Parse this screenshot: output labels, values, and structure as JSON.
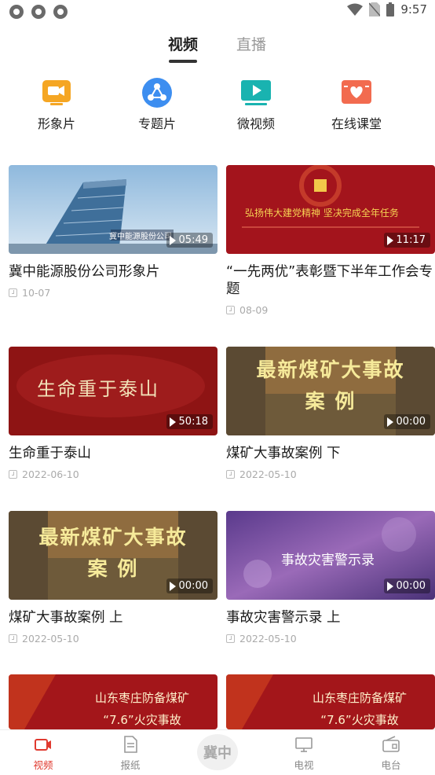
{
  "status_bar": {
    "time": "9:57"
  },
  "top_tabs": [
    {
      "label": "视频",
      "active": true
    },
    {
      "label": "直播",
      "active": false
    }
  ],
  "categories": [
    {
      "label": "形象片",
      "icon": "camera-icon",
      "color": "#f5a623"
    },
    {
      "label": "专题片",
      "icon": "share-circle-icon",
      "color": "#3d8ef0"
    },
    {
      "label": "微视频",
      "icon": "play-screen-icon",
      "color": "#19b3b0"
    },
    {
      "label": "在线课堂",
      "icon": "heart-board-icon",
      "color": "#f26b4f"
    }
  ],
  "videos": [
    {
      "title": "冀中能源股份公司形象片",
      "date": "10-07",
      "duration": "05:49",
      "thumb_text": "冀中能源股份公司"
    },
    {
      "title": "“一先两优”表彰暨下半年工作会专题",
      "date": "08-09",
      "duration": "11:17",
      "thumb_text": "弘扬伟大建党精神 坚决完成全年任务"
    },
    {
      "title": "生命重于泰山",
      "date": "2022-06-10",
      "duration": "50:18",
      "thumb_text": "生命重于泰山"
    },
    {
      "title": "煤矿大事故案例 下",
      "date": "2022-05-10",
      "duration": "00:00",
      "thumb_text": "最新煤矿大事故 案 例"
    },
    {
      "title": "煤矿大事故案例 上",
      "date": "2022-05-10",
      "duration": "00:00",
      "thumb_text": "最新煤矿大事故 案 例"
    },
    {
      "title": "事故灾害警示录 上",
      "date": "2022-05-10",
      "duration": "00:00",
      "thumb_text": "事故灾害警示录"
    },
    {
      "title": "",
      "date": "",
      "duration": "",
      "thumb_text": "山东枣庄防备煤矿 “7.6”火灾事故"
    },
    {
      "title": "",
      "date": "",
      "duration": "",
      "thumb_text": "山东枣庄防备煤矿 “7.6”火灾事故"
    }
  ],
  "bottom_nav": [
    {
      "label": "视频",
      "icon": "video-icon",
      "active": true
    },
    {
      "label": "报纸",
      "icon": "newspaper-icon",
      "active": false
    },
    {
      "label": "冀中",
      "icon": "home-badge",
      "active": false
    },
    {
      "label": "电视",
      "icon": "tv-icon",
      "active": false
    },
    {
      "label": "电台",
      "icon": "radio-icon",
      "active": false
    }
  ],
  "colors": {
    "accent": "#e03a2f",
    "active_tab": "#333333"
  }
}
